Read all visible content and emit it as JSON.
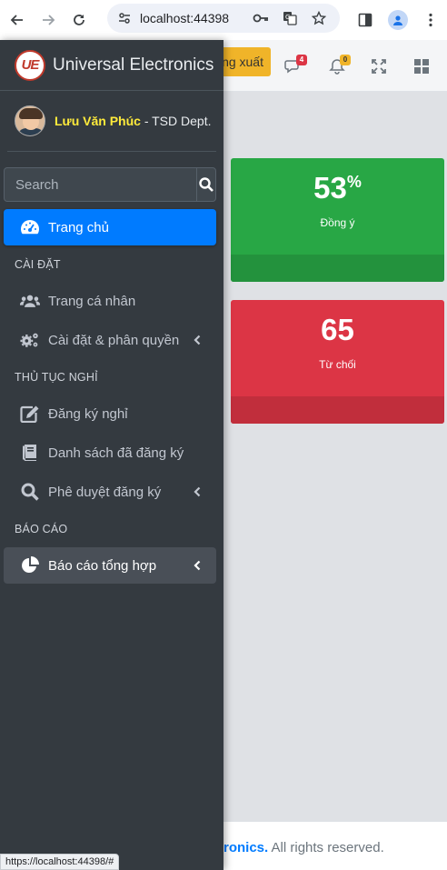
{
  "browser": {
    "url": "localhost:44398",
    "status_url": "https://localhost:44398/#"
  },
  "topbar": {
    "logout_label": "ng xuất",
    "messages_badge": "4",
    "notifications_badge": "0"
  },
  "cards": {
    "agree": {
      "value": "53",
      "unit": "%",
      "label": "Đồng ý"
    },
    "reject": {
      "value": "65",
      "label": "Từ chối"
    }
  },
  "footer": {
    "brand_fragment": "ronics.",
    "rights": " All rights reserved."
  },
  "sidebar": {
    "brand_logo": "UE",
    "brand_name": "Universal Electronics",
    "user_name": "Lưu Văn Phúc",
    "user_dept": " - TSD Dept.",
    "search_placeholder": "Search",
    "items": {
      "home": "Trang chủ",
      "header_settings": "CÀI ĐẶT",
      "profile": "Trang cá nhân",
      "settings_permissions": "Cài đặt & phân quyền",
      "header_leave": "THỦ TỤC NGHỈ",
      "register_leave": "Đăng ký nghỉ",
      "registered_list": "Danh sách đã đăng ký",
      "approve": "Phê duyệt đăng ký",
      "header_report": "BÁO CÁO",
      "summary_report": "Báo cáo tổng hợp"
    }
  },
  "colors": {
    "sidebar_bg": "#343a40",
    "active_item": "#007bff",
    "card_green": "#28a745",
    "card_red": "#dc3545",
    "logout_btn": "#f0b429",
    "user_name": "#ffeb3b"
  },
  "icons": [
    "back-icon",
    "forward-icon",
    "reload-icon",
    "site-info-icon",
    "key-icon",
    "translate-icon",
    "star-icon",
    "sidepanel-icon",
    "profile-icon",
    "more-icon",
    "comments-icon",
    "bell-icon",
    "expand-icon",
    "grid-icon",
    "search-icon",
    "tachometer-icon",
    "users-icon",
    "cogs-icon",
    "edit-icon",
    "book-icon",
    "magnifier-icon",
    "pie-chart-icon",
    "chevron-left-icon"
  ]
}
